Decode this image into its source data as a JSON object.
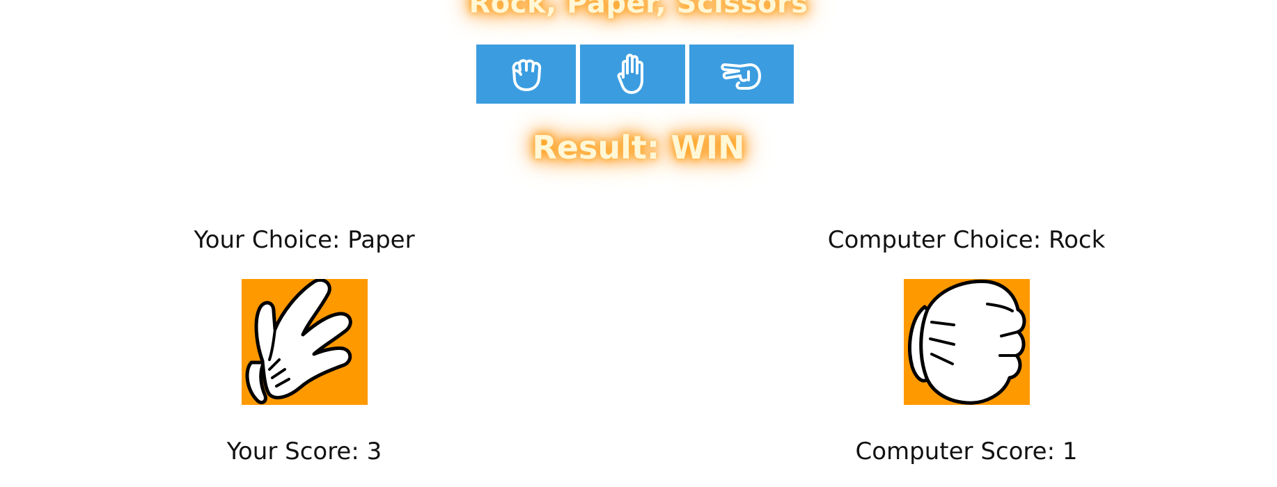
{
  "header": {
    "title": "Rock, Paper, Scissors"
  },
  "buttons": [
    {
      "label": "Rock",
      "icon": "rock-hand-icon"
    },
    {
      "label": "Paper",
      "icon": "paper-hand-icon"
    },
    {
      "label": "Scissors",
      "icon": "scissors-hand-icon"
    }
  ],
  "result": {
    "text": "Result: WIN"
  },
  "player": {
    "choice_text": "Your Choice: Paper",
    "score_text": "Your Score: 3",
    "hand_icon": "paper-hand-icon"
  },
  "computer": {
    "choice_text": "Computer Choice: Rock",
    "score_text": "Computer Score: 1",
    "hand_icon": "rock-hand-icon"
  },
  "colors": {
    "button": "#3b9de0",
    "hand_background": "#ff9900",
    "glow": "#ff9900",
    "text": "#111111"
  }
}
